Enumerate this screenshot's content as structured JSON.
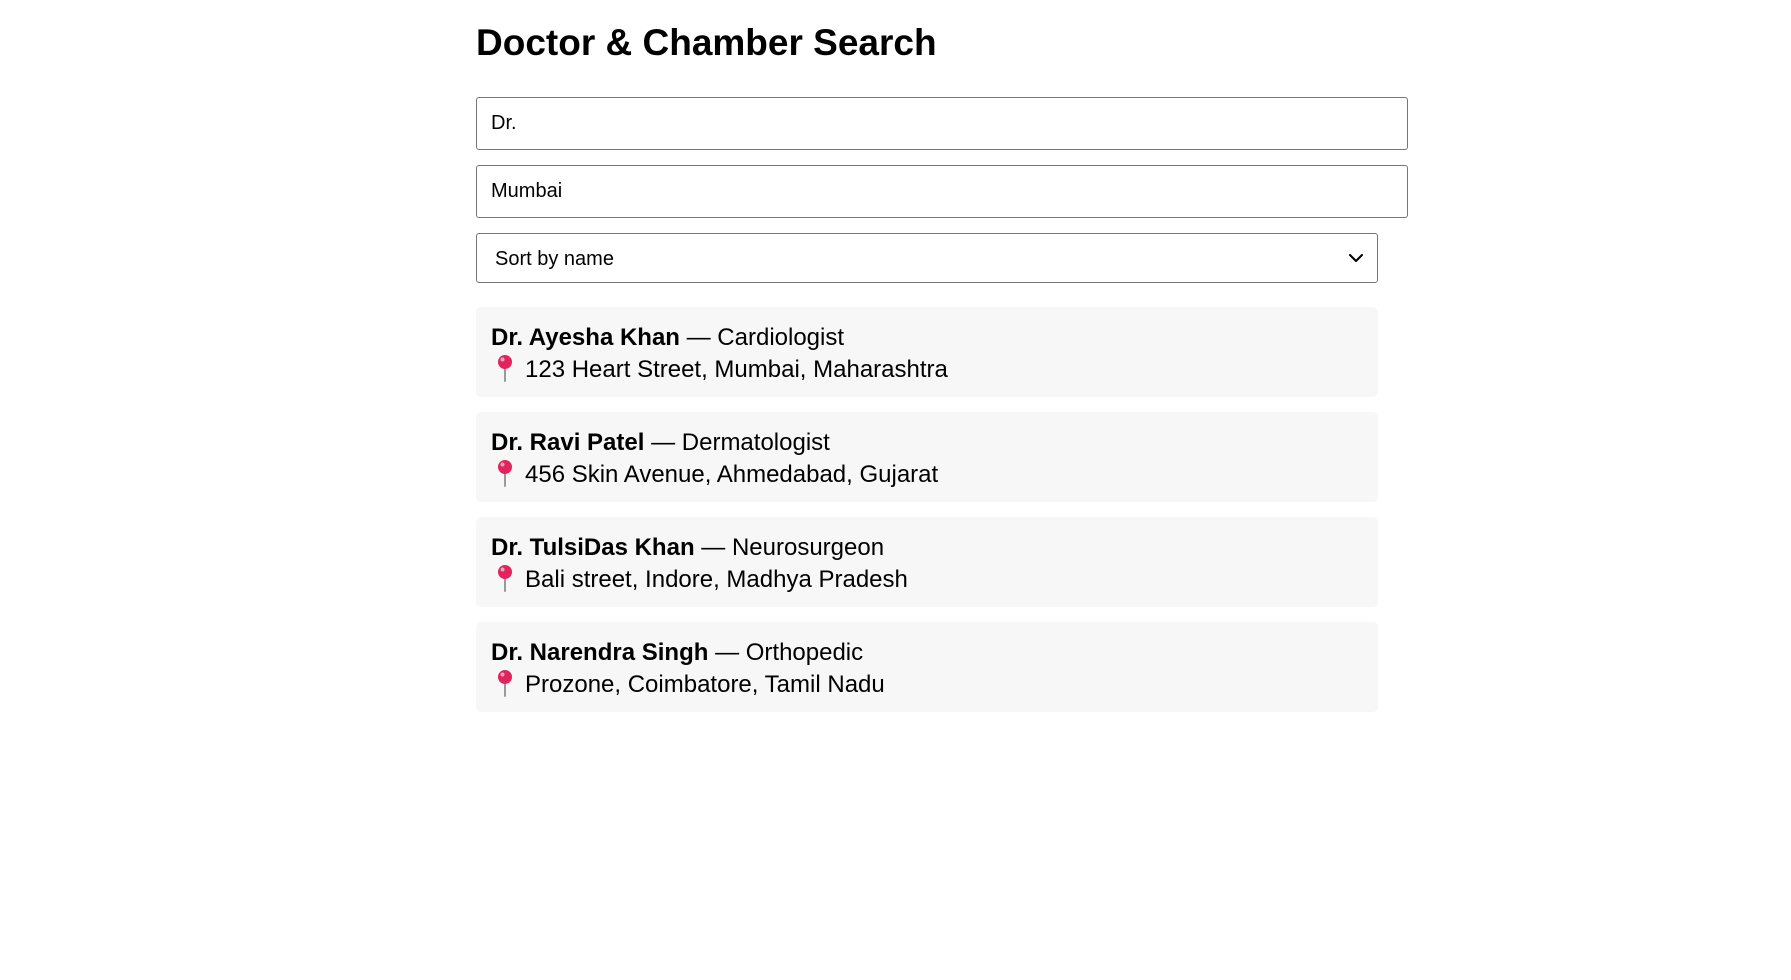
{
  "page": {
    "title": "Doctor & Chamber Search"
  },
  "search": {
    "name_value": "Dr.",
    "city_value": "Mumbai",
    "sort_selected": "Sort by name"
  },
  "results": [
    {
      "name": "Dr. Ayesha Khan",
      "specialty": "Cardiologist",
      "address": "123 Heart Street, Mumbai, Maharashtra"
    },
    {
      "name": "Dr. Ravi Patel",
      "specialty": "Dermatologist",
      "address": "456 Skin Avenue, Ahmedabad, Gujarat"
    },
    {
      "name": "Dr. TulsiDas Khan",
      "specialty": "Neurosurgeon",
      "address": "Bali street, Indore, Madhya Pradesh"
    },
    {
      "name": "Dr. Narendra Singh",
      "specialty": "Orthopedic",
      "address": "Prozone, Coimbatore, Tamil Nadu"
    }
  ],
  "separator": "—",
  "icons": {
    "location": "round-pushpin-icon",
    "dropdown": "chevron-down-icon"
  },
  "colors": {
    "pin": "#e0245e",
    "card_bg": "#f7f7f7"
  }
}
